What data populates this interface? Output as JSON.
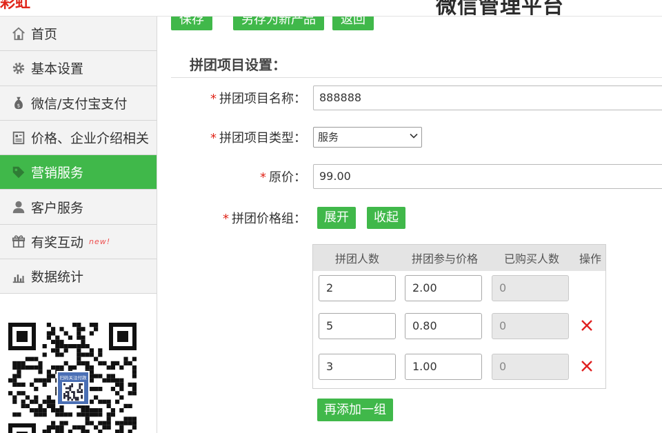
{
  "header": {
    "logo_fragment": "彩虹",
    "platform_title": "微信管理平台"
  },
  "sidebar": {
    "items": [
      {
        "label": "首页",
        "icon": "home-icon",
        "active": false
      },
      {
        "label": "基本设置",
        "icon": "gear-icon",
        "active": false
      },
      {
        "label": "微信/支付宝支付",
        "icon": "money-bag-icon",
        "active": false
      },
      {
        "label": "价格、企业介绍相关",
        "icon": "document-icon",
        "active": false
      },
      {
        "label": "营销服务",
        "icon": "tag-icon",
        "active": true
      },
      {
        "label": "客户服务",
        "icon": "user-icon",
        "active": false
      },
      {
        "label": "有奖互动",
        "icon": "gift-icon",
        "active": false,
        "badge": "new!"
      },
      {
        "label": "数据统计",
        "icon": "bar-chart-icon",
        "active": false
      }
    ],
    "qr_overlay_text": "扫码关注付款"
  },
  "toolbar": {
    "save_label": "保存",
    "save_as_new_label": "另存为新产品",
    "back_label": "返回"
  },
  "section": {
    "title": "拼团项目设置："
  },
  "form": {
    "required_mark": "*",
    "name_label": "拼团项目名称：",
    "name_value": "888888",
    "type_label": "拼团项目类型：",
    "type_value": "服务",
    "price_label": "原价：",
    "price_value": "99.00",
    "group_label": "拼团价格组：",
    "expand_label": "展开",
    "collapse_label": "收起"
  },
  "price_table": {
    "headers": [
      "拼团人数",
      "拼团参与价格",
      "已购买人数",
      "操作"
    ],
    "rows": [
      {
        "people": "2",
        "price": "2.00",
        "bought": "0",
        "deletable": false
      },
      {
        "people": "5",
        "price": "0.80",
        "bought": "0",
        "deletable": true
      },
      {
        "people": "3",
        "price": "1.00",
        "bought": "0",
        "deletable": true
      }
    ],
    "add_label": "再添加一组"
  },
  "colors": {
    "accent_green": "#40b84a",
    "required_red": "#e0261a",
    "delete_red": "#e02020"
  }
}
